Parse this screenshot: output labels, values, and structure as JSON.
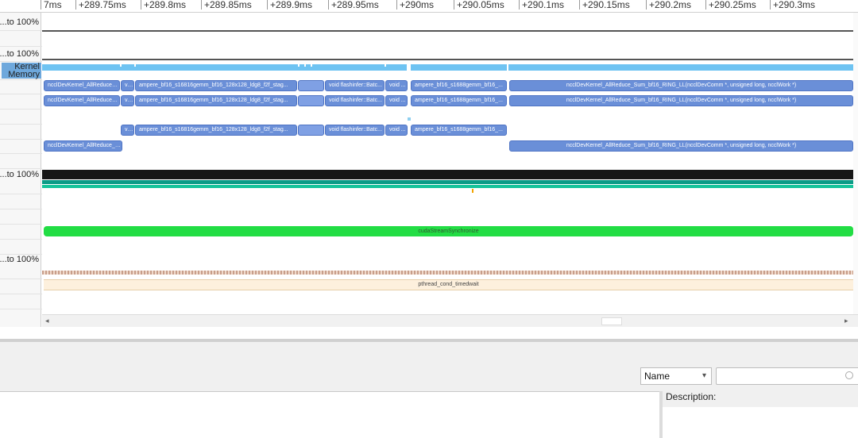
{
  "ruler": {
    "ticks": [
      "7ms",
      "+289.75ms",
      "+289.8ms",
      "+289.85ms",
      "+289.9ms",
      "+289.95ms",
      "+290ms",
      "+290.05ms",
      "+290.1ms",
      "+290.15ms",
      "+290.2ms",
      "+290.25ms",
      "+290.3ms"
    ]
  },
  "rows": {
    "gpu_util_label": "...to 100%",
    "mem_util_label": "...to 100%",
    "kernel_label": "Kernel",
    "memory_label": "Memory",
    "cpu_util_label": "...to 100%",
    "thread_util_label": "...to 100%"
  },
  "kernels": {
    "k1": "ncclDevKernel_AllReduce_...",
    "k2": "vo...",
    "k3": "ampere_bf16_s16816gemm_bf16_128x128_ldg8_f2f_stag...",
    "k4": "void flashinfer::Batc...",
    "k5": "void ...",
    "k6": "ampere_bf16_s1688gemm_bf16_...",
    "k7": "ncclDevKernel_AllReduce_Sum_bf16_RING_LL(ncclDevComm *, unsigned long, ncclWork *)",
    "k8": "ncclDevKernel_AllReduce_S..."
  },
  "cpu": {
    "sync_label": "cudaStreamSynchronize",
    "pthread_label": "pthread_cond_timedwait"
  },
  "bottom": {
    "sort_value": "Name",
    "search_placeholder": "",
    "description_label": "Description:"
  },
  "colors": {
    "kernel_bar": "#6a8fd8",
    "memory_bar": "#6ec3f2",
    "sync_bar": "#22dd44",
    "pthread_bar": "#fdf0dd"
  }
}
